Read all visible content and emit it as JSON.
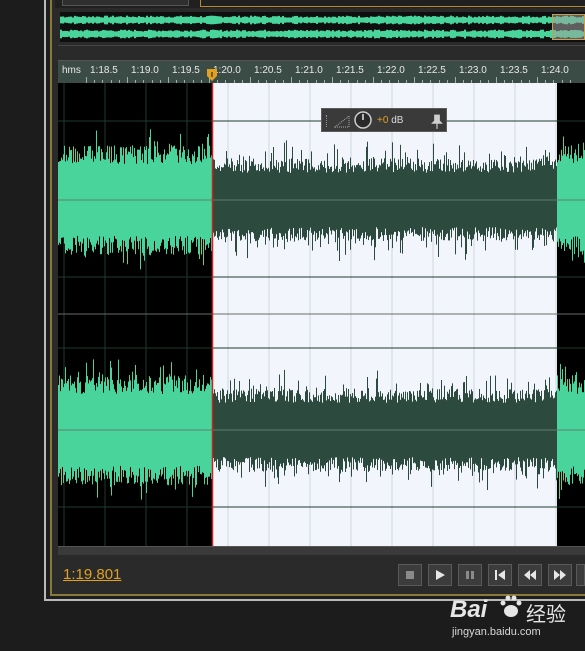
{
  "ruler": {
    "unit_label": "hms",
    "ticks": [
      "1:18.5",
      "1:19.0",
      "1:19.5",
      "1:20.0",
      "1:20.5",
      "1:21.0",
      "1:21.5",
      "1:22.0",
      "1:22.5",
      "1:23.0",
      "1:23.5",
      "1:24.0"
    ]
  },
  "hud": {
    "value": "+0",
    "unit": "dB"
  },
  "time_display": "1:19.801",
  "transport": [
    "stop",
    "play",
    "pause",
    "go-to-start",
    "rewind",
    "fast-forward",
    "go-to-end"
  ],
  "watermark": {
    "brand": "Bai",
    "brand_suffix": "百",
    "brand_cn": "经验",
    "url": "jingyan.baidu.com"
  },
  "colors": {
    "waveform": "#48d49a",
    "waveform_selected": "#2c4a3d",
    "selection_bg": "#f2f5fb",
    "accent": "#e0a020"
  }
}
